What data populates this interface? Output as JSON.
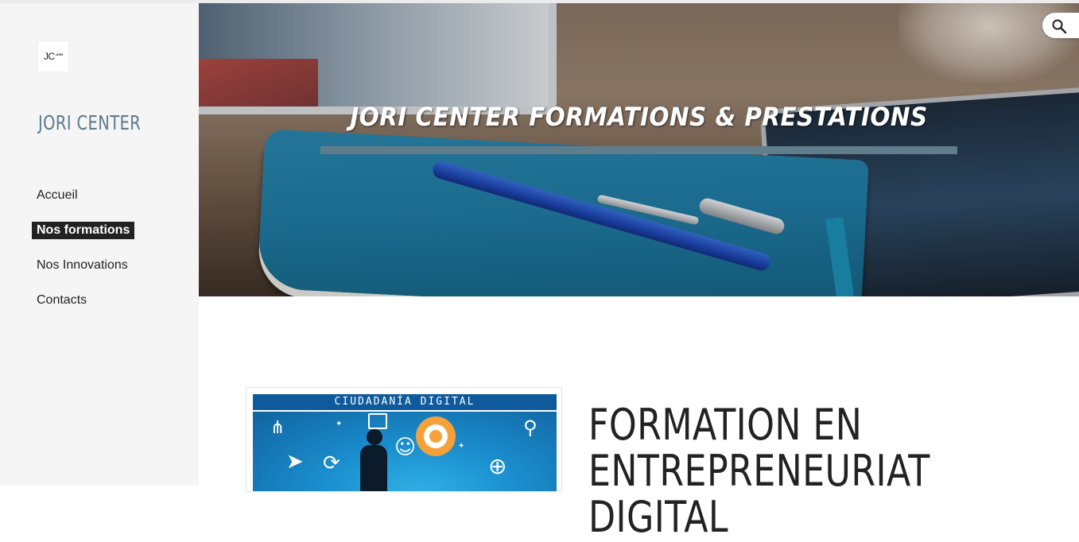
{
  "sidebar": {
    "logo_text": "JC",
    "logo_subtext": "JORI",
    "site_title": "JORI CENTER",
    "nav": [
      {
        "label": "Accueil",
        "active": false
      },
      {
        "label": "Nos formations",
        "active": true
      },
      {
        "label": "Nos Innovations",
        "active": false
      },
      {
        "label": "Contacts",
        "active": false
      }
    ]
  },
  "hero": {
    "title": "JORI CENTER FORMATIONS & PRESTATIONS",
    "bar_color": "#607d8b"
  },
  "search": {
    "icon": "search-icon"
  },
  "content": {
    "image_banner_text": "CIUDADANÍA  DIGITAL",
    "title": "FORMATION EN ENTREPRENEURIAT DIGITAL"
  },
  "colors": {
    "sidebar_bg": "#f5f5f5",
    "site_title": "#5b7b8d",
    "active_nav_bg": "#222222",
    "accent_bar": "#607d8b"
  }
}
